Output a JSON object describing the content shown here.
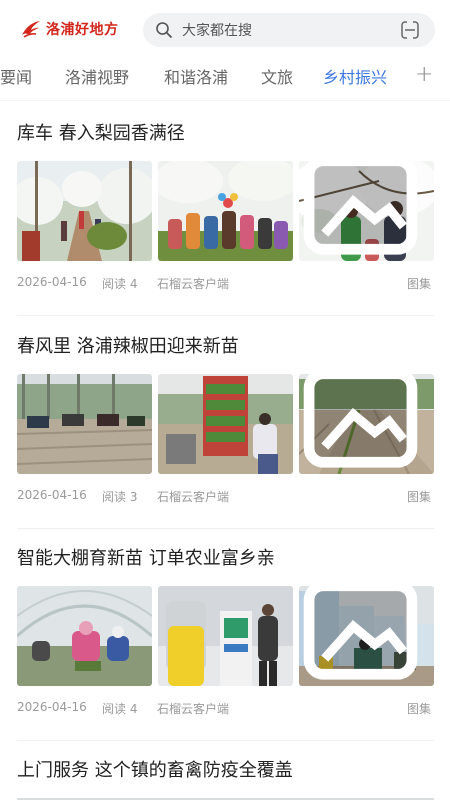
{
  "header": {
    "brand": "洛浦好地方",
    "search_placeholder": "大家都在搜"
  },
  "tabs": [
    {
      "label": "要闻"
    },
    {
      "label": "洛浦视野"
    },
    {
      "label": "和谐洛浦"
    },
    {
      "label": "文旅"
    },
    {
      "label": "乡村振兴",
      "active": true
    }
  ],
  "tab_more": "+",
  "colors": {
    "brand": "#d3271e",
    "active_tab": "#3b78e0",
    "meta_text": "#9a9a9a"
  },
  "articles": [
    {
      "title": "库车  春入梨园香满径",
      "date": "2026-04-16",
      "reads": "阅读 4",
      "source": "石榴云客户端",
      "type_label": "图集",
      "images": [
        "pear-orchard-path",
        "pear-orchard-group-photo",
        "pear-blossom-women"
      ]
    },
    {
      "title": "春风里  洛浦辣椒田迎来新苗",
      "date": "2026-04-16",
      "reads": "阅读 3",
      "source": "石榴云客户端",
      "type_label": "图集",
      "images": [
        "tractors-in-field",
        "seedling-trays-worker",
        "planted-field-rows"
      ]
    },
    {
      "title": "智能大棚育新苗  订单农业富乡亲",
      "date": "2026-04-16",
      "reads": "阅读 4",
      "source": "石榴云客户端",
      "type_label": "图集",
      "images": [
        "greenhouse-workers",
        "greenhouse-equipment",
        "greenhouse-row-vehicles"
      ]
    },
    {
      "title": "上门服务  这个镇的畜禽防疫全覆盖"
    }
  ]
}
